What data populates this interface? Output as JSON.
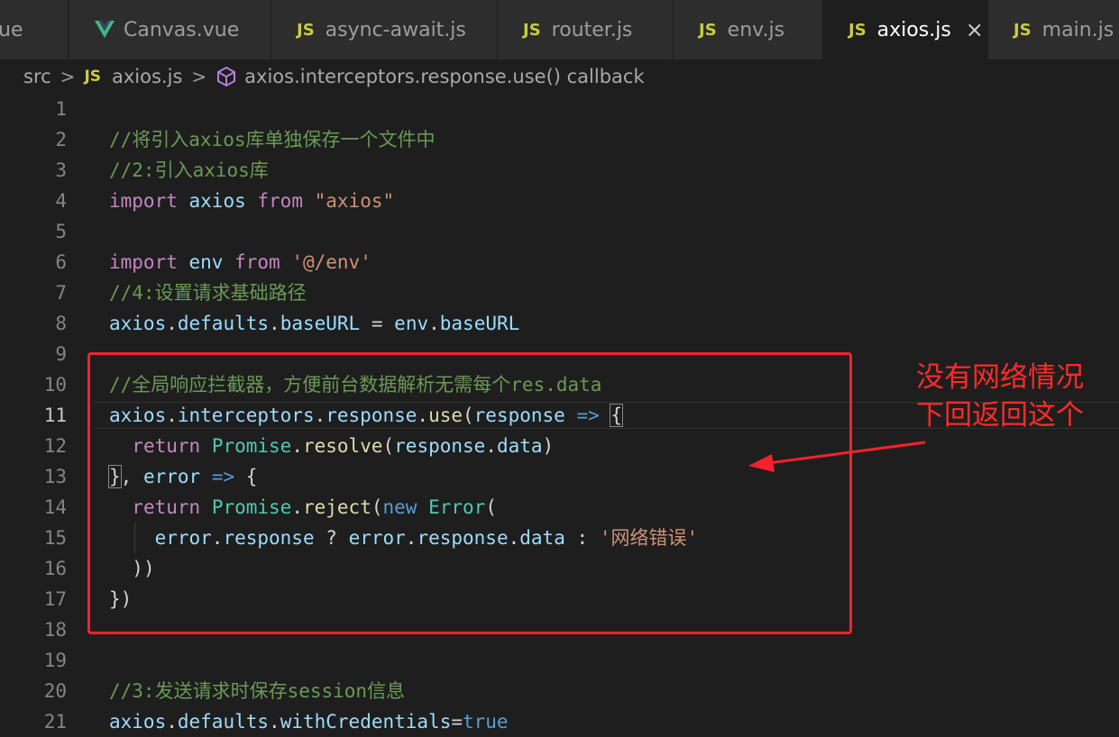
{
  "tabs": [
    {
      "label": "ue",
      "kind": "vue-partial",
      "active": false
    },
    {
      "label": "Canvas.vue",
      "kind": "vue",
      "active": false
    },
    {
      "label": "async-await.js",
      "kind": "js",
      "active": false
    },
    {
      "label": "router.js",
      "kind": "js",
      "active": false
    },
    {
      "label": "env.js",
      "kind": "js",
      "active": false
    },
    {
      "label": "axios.js",
      "kind": "js",
      "active": true
    },
    {
      "label": "main.js",
      "kind": "js",
      "active": false
    }
  ],
  "js_icon_text": "JS",
  "close_icon_char": "×",
  "breadcrumb": {
    "folder": "src",
    "file": "axios.js",
    "symbol": "axios.interceptors.response.use() callback",
    "separator": ">"
  },
  "line_numbers": [
    "1",
    "2",
    "3",
    "4",
    "5",
    "6",
    "7",
    "8",
    "9",
    "10",
    "11",
    "12",
    "13",
    "14",
    "15",
    "16",
    "17",
    "18",
    "19",
    "20",
    "21"
  ],
  "current_line": "11",
  "code": {
    "l2_comment": "//将引入axios库单独保存一个文件中",
    "l3_comment": "//2:引入axios库",
    "l4_import": "import",
    "l4_axios": "axios",
    "l4_from": "from",
    "l4_str": "\"axios\"",
    "l6_import": "import",
    "l6_env": "env",
    "l6_from": "from",
    "l6_str": "'@/env'",
    "l7_comment": "//4:设置请求基础路径",
    "l8_axios": "axios",
    "l8_defaults": "defaults",
    "l8_baseURL": "baseURL",
    "l8_eq": "=",
    "l8_env": "env",
    "l8_baseURL2": "baseURL",
    "l10_comment": "//全局响应拦截器，方便前台数据解析无需每个res.data",
    "l11_axios": "axios",
    "l11_interceptors": "interceptors",
    "l11_response": "response",
    "l11_use": "use",
    "l11_param": "response",
    "l11_arrow": "=>",
    "l11_brace": "{",
    "l12_return": "return",
    "l12_promise": "Promise",
    "l12_resolve": "resolve",
    "l12_response": "response",
    "l12_data": "data",
    "l13_brace": "}",
    "l13_error": "error",
    "l13_arrow": "=>",
    "l13_open": "{",
    "l14_return": "return",
    "l14_promise": "Promise",
    "l14_reject": "reject",
    "l14_new": "new",
    "l14_error": "Error",
    "l15_error": "error",
    "l15_response": "response",
    "l15_q": "?",
    "l15_error2": "error",
    "l15_response2": "response",
    "l15_data": "data",
    "l15_colon": ":",
    "l15_str": "'网络错误'",
    "l16_close": "))",
    "l17_close": "})",
    "l20_comment": "//3:发送请求时保存session信息",
    "l21_axios": "axios",
    "l21_defaults": "defaults",
    "l21_withCredentials": "withCredentials",
    "l21_true": "true"
  },
  "annotation": {
    "line1": "没有网络情况",
    "line2": "下回返回这个",
    "color": "#ff2a2a"
  },
  "colors": {
    "editor_bg": "#1e1e1e",
    "tab_bg": "#2d2d2d",
    "keyword": "#c586c0",
    "variable": "#9cdcfe",
    "string": "#ce9178",
    "comment": "#6a9955",
    "function": "#dcdcaa",
    "class": "#4ec9b0",
    "js_icon": "#cbcb41",
    "vue_icon": "#41b883"
  }
}
